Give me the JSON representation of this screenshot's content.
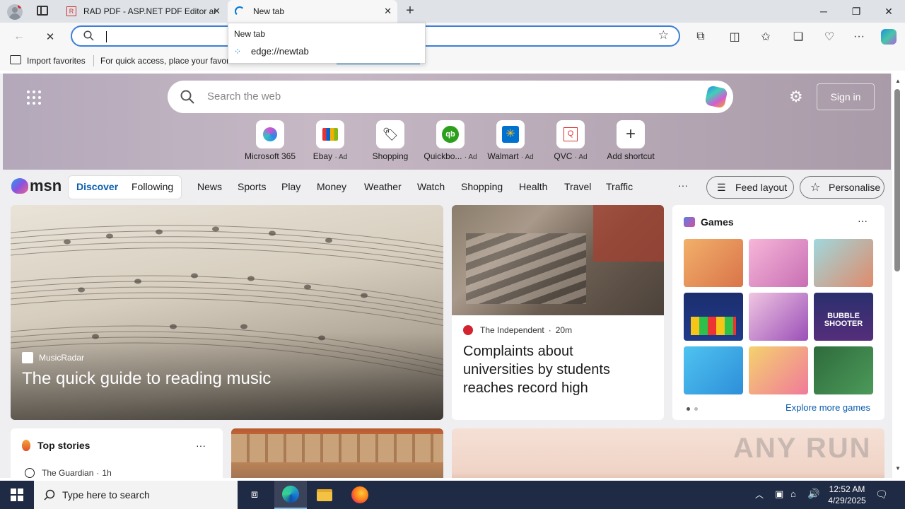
{
  "tabs": [
    {
      "title": "RAD PDF - ASP.NET PDF Editor ar"
    },
    {
      "title": "New tab"
    }
  ],
  "dropdown": {
    "title": "New tab",
    "url": "edge://newtab"
  },
  "favorites": {
    "import_label": "Import favorites",
    "hint": "For quick access, place your favori"
  },
  "hero": {
    "search_placeholder": "Search the web",
    "signin_label": "Sign in",
    "shortcuts": [
      {
        "label": "Microsoft 365",
        "ad": ""
      },
      {
        "label": "Ebay",
        "ad": "· Ad"
      },
      {
        "label": "Shopping",
        "ad": ""
      },
      {
        "label": "Quickbo...",
        "ad": "· Ad"
      },
      {
        "label": "Walmart",
        "ad": "· Ad"
      },
      {
        "label": "QVC",
        "ad": "· Ad"
      },
      {
        "label": "Add shortcut",
        "ad": ""
      }
    ]
  },
  "msn": {
    "logo": "msn",
    "tabs": [
      "Discover",
      "Following"
    ],
    "nav": [
      "News",
      "Sports",
      "Play",
      "Money",
      "Weather",
      "Watch",
      "Shopping",
      "Health",
      "Travel",
      "Traffic"
    ],
    "more": "···",
    "feed_layout": "Feed layout",
    "personalise": "Personalise"
  },
  "cards": {
    "main": {
      "source": "MusicRadar",
      "headline": "The quick guide to reading music"
    },
    "second": {
      "source": "The Independent",
      "time": "20m",
      "headline": "Complaints about universities by students reaches record high"
    },
    "games": {
      "title": "Games",
      "more": "···",
      "explore": "Explore more games"
    },
    "top_stories": {
      "title": "Top stories",
      "more": "···",
      "source": "The Guardian",
      "time": "1h"
    }
  },
  "watermark": "ANY RUN",
  "taskbar": {
    "search_placeholder": "Type here to search",
    "time": "12:52 AM",
    "date": "4/29/2025"
  },
  "colors": {
    "accent": "#0078d4",
    "address_border": "#3b7fd6",
    "taskbar": "#1f2a44"
  }
}
